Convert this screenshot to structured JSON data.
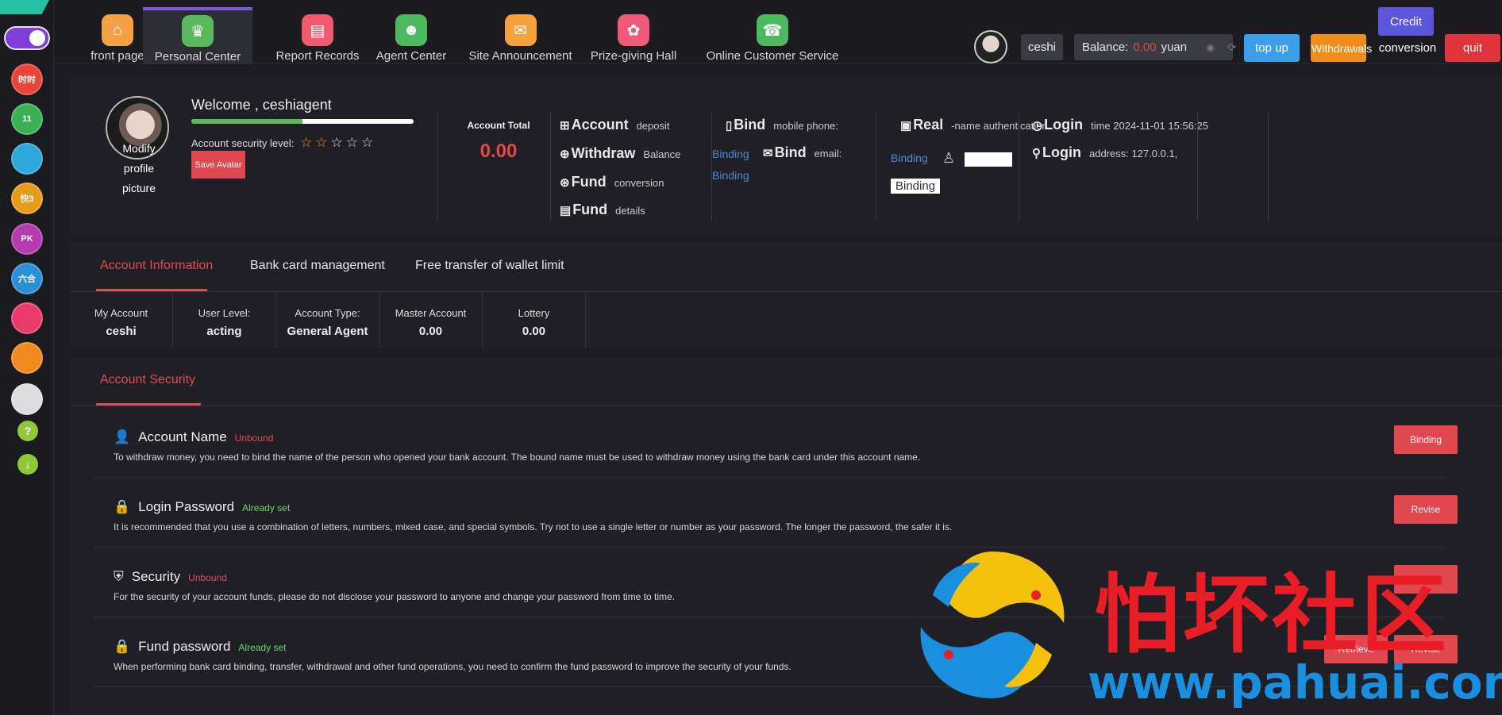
{
  "nav": {
    "items": [
      {
        "label": "front page",
        "icon": "home-icon",
        "color": "#f4a146"
      },
      {
        "label": "Personal Center",
        "icon": "crown-icon",
        "color": "#5cb85c"
      },
      {
        "label": "Report Records",
        "icon": "report-icon",
        "color": "#ef5a6f"
      },
      {
        "label": "Agent Center",
        "icon": "agent-icon",
        "color": "#4cb860"
      },
      {
        "label": "Site Announcement",
        "icon": "mail-icon",
        "color": "#f5a13c"
      },
      {
        "label": "Prize-giving Hall",
        "icon": "prize-icon",
        "color": "#ef5a7a"
      },
      {
        "label": "Online Customer Service",
        "icon": "support-icon",
        "color": "#4cb860"
      }
    ]
  },
  "header": {
    "username": "ceshi",
    "balance_label": "Balance:",
    "balance_value": "0.00",
    "balance_unit": "yuan",
    "top_up": "top up",
    "withdrawals": "Withdrawals",
    "conversion": "conversion",
    "quit": "quit",
    "credit": "Credit"
  },
  "sidebar": {
    "games": [
      {
        "label": "时时",
        "color": "#e8443a"
      },
      {
        "label": "11",
        "color": "#3ab055"
      },
      {
        "label": "",
        "color": "#2da8d8"
      },
      {
        "label": "快3",
        "color": "#e59b1c"
      },
      {
        "label": "PK",
        "color": "#b53ab0"
      },
      {
        "label": "六合",
        "color": "#2a8fd6"
      },
      {
        "label": "",
        "color": "#e93b6b"
      },
      {
        "label": "",
        "color": "#f08a1e"
      }
    ],
    "help": "?",
    "download": "↓"
  },
  "profile": {
    "modify": "Modify profile picture",
    "welcome": "Welcome , ceshiagent",
    "security_level": "Account security level:",
    "stars_on": 2,
    "stars_total": 5,
    "progress": 0.5,
    "save_avatar": "Save Avatar",
    "account_total_label": "Account Total",
    "account_total_value": "0.00",
    "funcs": [
      {
        "big": "Account",
        "small": "deposit"
      },
      {
        "big": "Withdraw",
        "small": "Balance"
      },
      {
        "big": "Fund",
        "small": "conversion"
      },
      {
        "big": "Fund",
        "small": "details"
      }
    ],
    "bind_phone_big": "Bind",
    "bind_phone_small": "mobile phone:",
    "bind_phone_link": "Binding",
    "bind_email_big": "Bind",
    "bind_email_small": "email:",
    "bind_email_link": "Binding",
    "real_big": "Real",
    "real_small": "-name authentication",
    "real_link": "Binding",
    "real_button": "Binding",
    "login_time_big": "Login",
    "login_time_small": "time 2024-11-01 15:56:25",
    "login_addr_big": "Login",
    "login_addr_small": "address: 127.0.0.1,"
  },
  "info": {
    "tabs": [
      "Account Information",
      "Bank card management",
      "Free transfer of wallet limit"
    ],
    "cells": [
      {
        "label": "My Account",
        "value": "ceshi"
      },
      {
        "label": "User Level:",
        "value": "acting"
      },
      {
        "label": "Account Type:",
        "value": "General Agent"
      },
      {
        "label": "Master Account",
        "value": "0.00"
      },
      {
        "label": "Lottery",
        "value": "0.00"
      }
    ]
  },
  "security": {
    "tab": "Account Security",
    "rows": [
      {
        "title": "Account Name",
        "status": "Unbound",
        "desc": "To withdraw money, you need to bind the name of the person who opened your bank account. The bound name must be used to withdraw money using the bank card under this account name.",
        "button": "Binding"
      },
      {
        "title": "Login Password",
        "status": "Already set",
        "desc": "It is recommended that you use a combination of letters, numbers, mixed case, and special symbols. Try not to use a single letter or number as your password. The longer the password, the safer it is.",
        "button": "Revise"
      },
      {
        "title": "Security",
        "status": "Unbound",
        "desc": "For the security of your account funds, please do not disclose your password to anyone and change your password from time to time.",
        "button": "Set"
      },
      {
        "title": "Fund password",
        "status": "Already set",
        "desc": "When performing bank card binding, transfer, withdrawal and other fund operations, you need to confirm the fund password to improve the security of your funds.",
        "button": "Revise",
        "button2": "Retrieve"
      }
    ]
  },
  "watermark": {
    "text": "怕坏社区",
    "url": "www.pahuai.com"
  }
}
